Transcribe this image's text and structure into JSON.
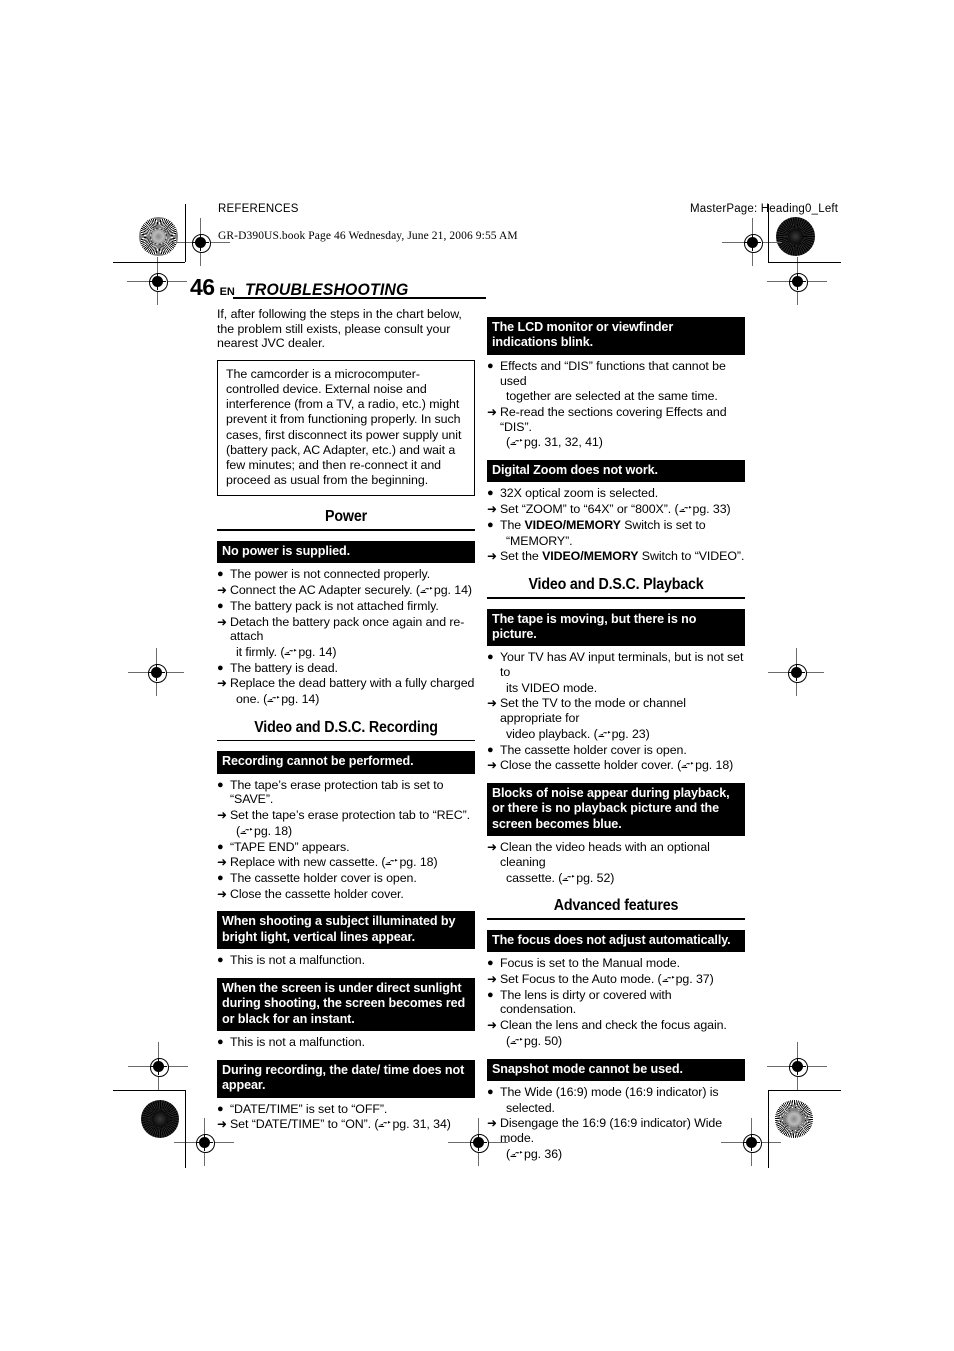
{
  "header": {
    "left_label": "REFERENCES",
    "right_label": "MasterPage: Heading0_Left",
    "book_line": "GR-D390US.book  Page 46  Wednesday, June 21, 2006  9:55 AM"
  },
  "title": {
    "page_number": "46",
    "language": "EN",
    "chapter": "TROUBLESHOOTING"
  },
  "intro": "If, after following the steps in the chart below, the problem still exists, please consult your nearest JVC dealer.",
  "note_box": "The camcorder is a microcomputer-controlled device. External noise and interference (from a TV, a radio, etc.) might prevent it from functioning properly. In such cases, first disconnect its power supply unit (battery pack, AC Adapter, etc.) and wait a few minutes; and then re-connect it and proceed as usual from the beginning.",
  "markers": {
    "bullet": "●",
    "arrow": "➜"
  },
  "left_column": {
    "sections": [
      {
        "heading": "Power",
        "entries": [
          {
            "symptom": "No power is supplied.",
            "items": [
              {
                "type": "bullet",
                "text": "The power is not connected properly."
              },
              {
                "type": "arrow",
                "text": "Connect the AC Adapter securely. (",
                "pgref": "pg. 14",
                "tail": ")"
              },
              {
                "type": "bullet",
                "text": "The battery pack is not attached firmly."
              },
              {
                "type": "arrow",
                "text": "Detach the battery pack once again and re-attach"
              },
              {
                "type": "cont",
                "text": "it firmly. (",
                "pgref": "pg. 14",
                "tail": ")"
              },
              {
                "type": "bullet",
                "text": "The battery is dead."
              },
              {
                "type": "arrow",
                "text": "Replace the dead battery with a fully charged"
              },
              {
                "type": "cont",
                "text": "one. (",
                "pgref": "pg. 14",
                "tail": ")"
              }
            ]
          }
        ]
      },
      {
        "heading": "Video and D.S.C. Recording",
        "entries": [
          {
            "symptom": "Recording cannot be performed.",
            "items": [
              {
                "type": "bullet",
                "text": "The tape’s erase protection tab is set to “SAVE”."
              },
              {
                "type": "arrow",
                "text": "Set the tape’s erase protection tab to “REC”."
              },
              {
                "type": "cont",
                "text": "(",
                "pgref": "pg. 18",
                "tail": ")"
              },
              {
                "type": "bullet",
                "text": "“TAPE END” appears."
              },
              {
                "type": "arrow",
                "text": "Replace with new cassette. (",
                "pgref": "pg. 18",
                "tail": ")"
              },
              {
                "type": "bullet",
                "text": "The cassette holder cover is open."
              },
              {
                "type": "arrow",
                "text": "Close the cassette holder cover."
              }
            ]
          },
          {
            "symptom": "When shooting a subject illuminated by bright light, vertical lines appear.",
            "items": [
              {
                "type": "bullet",
                "text": "This is not a malfunction."
              }
            ]
          },
          {
            "symptom": "When the screen is under direct sunlight during shooting, the screen becomes red or black for an instant.",
            "items": [
              {
                "type": "bullet",
                "text": "This is not a malfunction."
              }
            ]
          },
          {
            "symptom": "During recording, the date/ time does not appear.",
            "items": [
              {
                "type": "bullet",
                "text": "“DATE/TIME” is set to “OFF”."
              },
              {
                "type": "arrow",
                "text": "Set “DATE/TIME” to “ON”. (",
                "pgref": "pg. 31, 34",
                "tail": ")"
              }
            ]
          }
        ]
      }
    ]
  },
  "right_column": {
    "lead_entries": [
      {
        "symptom": "The LCD monitor or viewfinder indications blink.",
        "items": [
          {
            "type": "bullet",
            "text": "Effects and “DIS” functions that cannot be used"
          },
          {
            "type": "cont",
            "text": "together are selected at the same time."
          },
          {
            "type": "arrow",
            "text": "Re-read the sections covering Effects and “DIS”."
          },
          {
            "type": "cont",
            "text": "(",
            "pgref": "pg. 31, 32, 41",
            "tail": ")"
          }
        ]
      },
      {
        "symptom": "Digital Zoom does not work.",
        "items": [
          {
            "type": "bullet",
            "text": "32X optical zoom is selected."
          },
          {
            "type": "arrow",
            "text": "Set “ZOOM” to “64X” or “800X”. (",
            "pgref": "pg. 33",
            "tail": ")"
          },
          {
            "type": "bullet",
            "text": "The ",
            "bold": "VIDEO/MEMORY",
            "text2": " Switch is set to"
          },
          {
            "type": "cont",
            "text": "“MEMORY”."
          },
          {
            "type": "arrow",
            "text": "Set the ",
            "bold": "VIDEO/MEMORY",
            "text2": " Switch to “VIDEO”."
          }
        ]
      }
    ],
    "sections": [
      {
        "heading": "Video and D.S.C. Playback",
        "entries": [
          {
            "symptom": "The tape is moving, but there is no picture.",
            "items": [
              {
                "type": "bullet",
                "text": "Your TV has AV input terminals, but is not set to"
              },
              {
                "type": "cont",
                "text": "its VIDEO mode."
              },
              {
                "type": "arrow",
                "text": "Set the TV to the mode or channel appropriate for"
              },
              {
                "type": "cont",
                "text": "video playback. (",
                "pgref": "pg. 23",
                "tail": ")"
              },
              {
                "type": "bullet",
                "text": "The cassette holder cover is open."
              },
              {
                "type": "arrow",
                "text": "Close the cassette holder cover. (",
                "pgref": "pg. 18",
                "tail": ")"
              }
            ]
          },
          {
            "symptom": "Blocks of noise appear during playback, or there is no playback picture and the screen becomes blue.",
            "items": [
              {
                "type": "arrow",
                "text": "Clean the video heads with an optional cleaning"
              },
              {
                "type": "cont",
                "text": "cassette. (",
                "pgref": "pg. 52",
                "tail": ")"
              }
            ]
          }
        ]
      },
      {
        "heading": "Advanced features",
        "entries": [
          {
            "symptom": "The focus does not adjust automatically.",
            "items": [
              {
                "type": "bullet",
                "text": "Focus is set to the Manual mode."
              },
              {
                "type": "arrow",
                "text": "Set Focus to the Auto mode. (",
                "pgref": "pg. 37",
                "tail": ")"
              },
              {
                "type": "bullet",
                "text": "The lens is dirty or covered with condensation."
              },
              {
                "type": "arrow",
                "text": "Clean the lens and check the focus again."
              },
              {
                "type": "cont",
                "text": "(",
                "pgref": "pg. 50",
                "tail": ")"
              }
            ]
          },
          {
            "symptom": "Snapshot mode cannot be used.",
            "items": [
              {
                "type": "bullet",
                "text": "The Wide (16:9) mode (16:9 indicator) is"
              },
              {
                "type": "cont",
                "text": "selected."
              },
              {
                "type": "arrow",
                "text": "Disengage the 16:9 (16:9 indicator) Wide mode."
              },
              {
                "type": "cont",
                "text": "(",
                "pgref": "pg. 36",
                "tail": ")"
              }
            ]
          }
        ]
      }
    ]
  }
}
